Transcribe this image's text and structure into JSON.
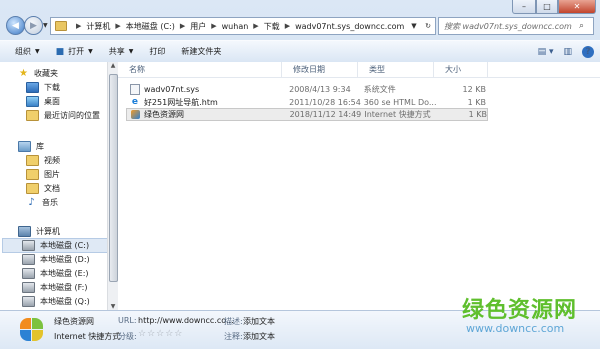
{
  "window": {
    "controls": {
      "minimize": "–",
      "maximize": "□",
      "close": "✕"
    }
  },
  "address": {
    "crumbs": [
      "计算机",
      "本地磁盘 (C:)",
      "用户",
      "wuhan",
      "下载",
      "wadv07nt.sys_downcc.com"
    ],
    "search_placeholder": "搜索 wadv07nt.sys_downcc.com"
  },
  "toolbar": {
    "organize": "组织",
    "open": "打开",
    "share": "共享",
    "print": "打印",
    "new_folder": "新建文件夹"
  },
  "nav": {
    "favorites": "收藏夹",
    "downloads": "下载",
    "desktop": "桌面",
    "recent": "最近访问的位置",
    "libraries": "库",
    "videos": "视频",
    "pictures": "图片",
    "documents": "文档",
    "music": "音乐",
    "computer": "计算机",
    "drives": [
      "本地磁盘 (C:)",
      "本地磁盘 (D:)",
      "本地磁盘 (E:)",
      "本地磁盘 (F:)",
      "本地磁盘 (Q:)"
    ]
  },
  "columns": {
    "name": "名称",
    "date": "修改日期",
    "type": "类型",
    "size": "大小"
  },
  "files": [
    {
      "name": "wadv07nt.sys",
      "date": "2008/4/13 9:34",
      "type": "系统文件",
      "size": "12 KB"
    },
    {
      "name": "好251网址导航.htm",
      "date": "2011/10/28 16:54",
      "type": "360 se HTML Do...",
      "size": "1 KB"
    },
    {
      "name": "绿色资源网",
      "date": "2018/11/12 14:49",
      "type": "Internet 快捷方式",
      "size": "1 KB"
    }
  ],
  "details": {
    "name": "绿色资源网",
    "type": "Internet 快捷方式",
    "url_label": "URL:",
    "url_value": "http://www.downcc.co...",
    "rating_label": "分级:",
    "stars": "☆☆☆☆☆",
    "desc_label": "描述:",
    "desc_value": "添加文本",
    "note_label": "注释:",
    "note_value": "添加文本"
  },
  "watermark": {
    "name": "绿色资源网",
    "url": "www.downcc.com"
  },
  "colors": {
    "accent": "#2c6cb8",
    "watermark_green": "#5fbf2d",
    "watermark_blue": "#5ea6d6"
  }
}
